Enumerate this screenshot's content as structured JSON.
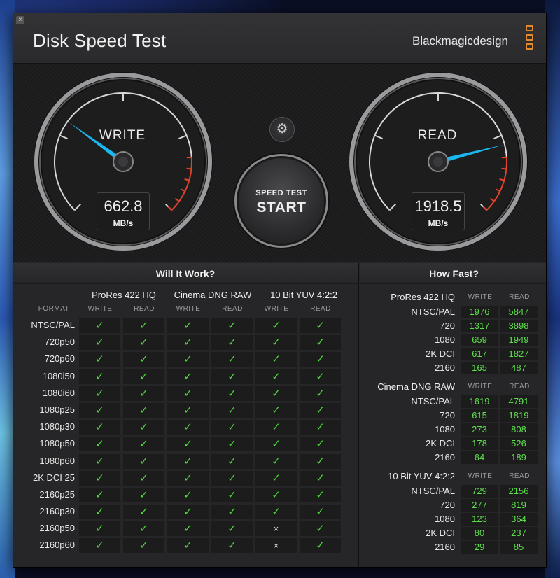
{
  "app": {
    "title": "Disk Speed Test",
    "brand": "Blackmagicdesign",
    "close_label": "×"
  },
  "gauges": {
    "write": {
      "label": "WRITE",
      "value": "662.8",
      "unit": "MB/s",
      "fraction": 0.3
    },
    "read": {
      "label": "READ",
      "value": "1918.5",
      "unit": "MB/s",
      "fraction": 0.78
    }
  },
  "controls": {
    "settings_icon": "gear-icon",
    "settings_glyph": "⚙",
    "start_small": "SPEED TEST",
    "start_big": "START"
  },
  "will_it_work": {
    "title": "Will It Work?",
    "format_header": "FORMAT",
    "groups": [
      "ProRes 422 HQ",
      "Cinema DNG RAW",
      "10 Bit YUV 4:2:2"
    ],
    "write_label": "WRITE",
    "read_label": "READ",
    "ok_glyph": "✓",
    "no_glyph": "×",
    "rows": [
      {
        "format": "NTSC/PAL",
        "cells": [
          1,
          1,
          1,
          1,
          1,
          1
        ]
      },
      {
        "format": "720p50",
        "cells": [
          1,
          1,
          1,
          1,
          1,
          1
        ]
      },
      {
        "format": "720p60",
        "cells": [
          1,
          1,
          1,
          1,
          1,
          1
        ]
      },
      {
        "format": "1080i50",
        "cells": [
          1,
          1,
          1,
          1,
          1,
          1
        ]
      },
      {
        "format": "1080i60",
        "cells": [
          1,
          1,
          1,
          1,
          1,
          1
        ]
      },
      {
        "format": "1080p25",
        "cells": [
          1,
          1,
          1,
          1,
          1,
          1
        ]
      },
      {
        "format": "1080p30",
        "cells": [
          1,
          1,
          1,
          1,
          1,
          1
        ]
      },
      {
        "format": "1080p50",
        "cells": [
          1,
          1,
          1,
          1,
          1,
          1
        ]
      },
      {
        "format": "1080p60",
        "cells": [
          1,
          1,
          1,
          1,
          1,
          1
        ]
      },
      {
        "format": "2K DCI 25",
        "cells": [
          1,
          1,
          1,
          1,
          1,
          1
        ]
      },
      {
        "format": "2160p25",
        "cells": [
          1,
          1,
          1,
          1,
          1,
          1
        ]
      },
      {
        "format": "2160p30",
        "cells": [
          1,
          1,
          1,
          1,
          1,
          1
        ]
      },
      {
        "format": "2160p50",
        "cells": [
          1,
          1,
          1,
          1,
          0,
          1
        ]
      },
      {
        "format": "2160p60",
        "cells": [
          1,
          1,
          1,
          1,
          0,
          1
        ]
      }
    ]
  },
  "how_fast": {
    "title": "How Fast?",
    "write_label": "WRITE",
    "read_label": "READ",
    "sections": [
      {
        "name": "ProRes 422 HQ",
        "rows": [
          {
            "label": "NTSC/PAL",
            "write": "1976",
            "read": "5847"
          },
          {
            "label": "720",
            "write": "1317",
            "read": "3898"
          },
          {
            "label": "1080",
            "write": "659",
            "read": "1949"
          },
          {
            "label": "2K DCI",
            "write": "617",
            "read": "1827"
          },
          {
            "label": "2160",
            "write": "165",
            "read": "487"
          }
        ]
      },
      {
        "name": "Cinema DNG RAW",
        "rows": [
          {
            "label": "NTSC/PAL",
            "write": "1619",
            "read": "4791"
          },
          {
            "label": "720",
            "write": "615",
            "read": "1819"
          },
          {
            "label": "1080",
            "write": "273",
            "read": "808"
          },
          {
            "label": "2K DCI",
            "write": "178",
            "read": "526"
          },
          {
            "label": "2160",
            "write": "64",
            "read": "189"
          }
        ]
      },
      {
        "name": "10 Bit YUV 4:2:2",
        "rows": [
          {
            "label": "NTSC/PAL",
            "write": "729",
            "read": "2156"
          },
          {
            "label": "720",
            "write": "277",
            "read": "819"
          },
          {
            "label": "1080",
            "write": "123",
            "read": "364"
          },
          {
            "label": "2K DCI",
            "write": "80",
            "read": "237"
          },
          {
            "label": "2160",
            "write": "29",
            "read": "85"
          }
        ]
      }
    ]
  },
  "colors": {
    "needle": "#1ab8f0",
    "redline": "#e0432c",
    "ok_green": "#4cdc3a",
    "value_green": "#5ce04a",
    "brand_orange": "#e38b2c"
  }
}
